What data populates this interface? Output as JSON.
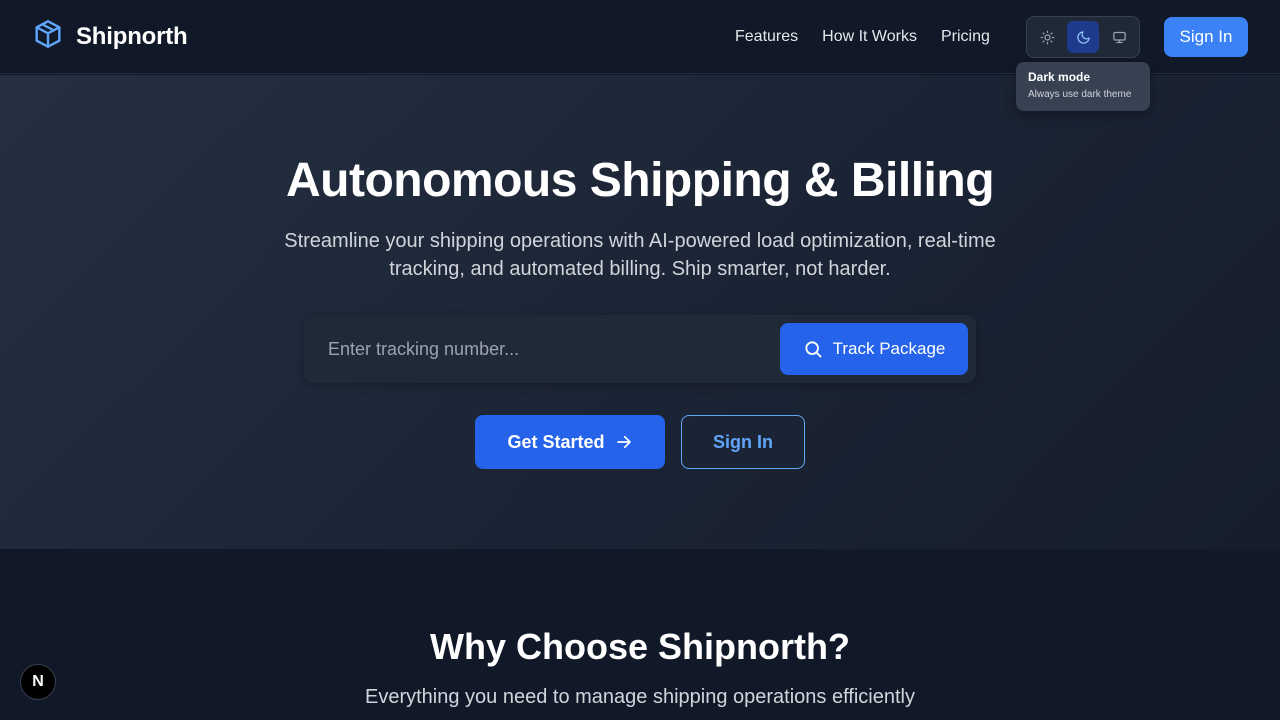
{
  "header": {
    "brand": "Shipnorth",
    "brand_icon": "package-cube-icon",
    "nav": [
      {
        "label": "Features"
      },
      {
        "label": "How It Works"
      },
      {
        "label": "Pricing"
      }
    ],
    "theme_options": [
      {
        "icon": "sun-icon",
        "name": "light"
      },
      {
        "icon": "moon-icon",
        "name": "dark",
        "active": true
      },
      {
        "icon": "monitor-icon",
        "name": "system"
      }
    ],
    "signin_label": "Sign In"
  },
  "tooltip": {
    "title": "Dark mode",
    "description": "Always use dark theme"
  },
  "hero": {
    "title": "Autonomous Shipping & Billing",
    "subtitle": "Streamline your shipping operations with AI-powered load optimization, real-time tracking, and automated billing. Ship smarter, not harder.",
    "tracking": {
      "placeholder": "Enter tracking number...",
      "value": "",
      "button_label": "Track Package"
    },
    "cta_primary": "Get Started",
    "cta_secondary": "Sign In"
  },
  "features": {
    "title": "Why Choose Shipnorth?",
    "subtitle": "Everything you need to manage shipping operations efficiently"
  },
  "badge": {
    "label": "N"
  },
  "colors": {
    "accent": "#2563eb",
    "accent_light": "#3b82f6",
    "background": "#111827",
    "outline": "#60a5fa"
  }
}
